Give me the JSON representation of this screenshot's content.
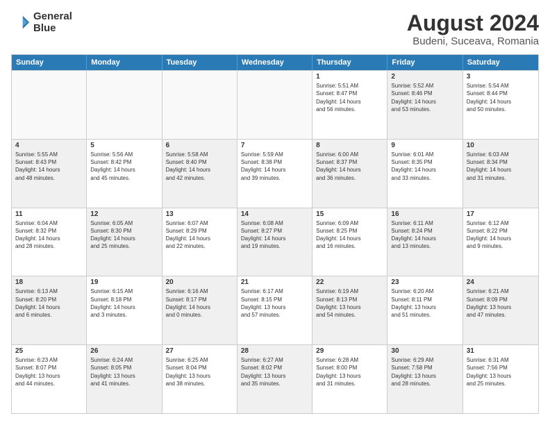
{
  "logo": {
    "line1": "General",
    "line2": "Blue"
  },
  "title": "August 2024",
  "subtitle": "Budeni, Suceava, Romania",
  "days": [
    "Sunday",
    "Monday",
    "Tuesday",
    "Wednesday",
    "Thursday",
    "Friday",
    "Saturday"
  ],
  "rows": [
    [
      {
        "day": "",
        "info": "",
        "empty": true
      },
      {
        "day": "",
        "info": "",
        "empty": true
      },
      {
        "day": "",
        "info": "",
        "empty": true
      },
      {
        "day": "",
        "info": "",
        "empty": true
      },
      {
        "day": "1",
        "info": "Sunrise: 5:51 AM\nSunset: 8:47 PM\nDaylight: 14 hours\nand 56 minutes.",
        "shaded": false
      },
      {
        "day": "2",
        "info": "Sunrise: 5:52 AM\nSunset: 8:46 PM\nDaylight: 14 hours\nand 53 minutes.",
        "shaded": true
      },
      {
        "day": "3",
        "info": "Sunrise: 5:54 AM\nSunset: 8:44 PM\nDaylight: 14 hours\nand 50 minutes.",
        "shaded": false
      }
    ],
    [
      {
        "day": "4",
        "info": "Sunrise: 5:55 AM\nSunset: 8:43 PM\nDaylight: 14 hours\nand 48 minutes.",
        "shaded": true
      },
      {
        "day": "5",
        "info": "Sunrise: 5:56 AM\nSunset: 8:42 PM\nDaylight: 14 hours\nand 45 minutes.",
        "shaded": false
      },
      {
        "day": "6",
        "info": "Sunrise: 5:58 AM\nSunset: 8:40 PM\nDaylight: 14 hours\nand 42 minutes.",
        "shaded": true
      },
      {
        "day": "7",
        "info": "Sunrise: 5:59 AM\nSunset: 8:38 PM\nDaylight: 14 hours\nand 39 minutes.",
        "shaded": false
      },
      {
        "day": "8",
        "info": "Sunrise: 6:00 AM\nSunset: 8:37 PM\nDaylight: 14 hours\nand 36 minutes.",
        "shaded": true
      },
      {
        "day": "9",
        "info": "Sunrise: 6:01 AM\nSunset: 8:35 PM\nDaylight: 14 hours\nand 33 minutes.",
        "shaded": false
      },
      {
        "day": "10",
        "info": "Sunrise: 6:03 AM\nSunset: 8:34 PM\nDaylight: 14 hours\nand 31 minutes.",
        "shaded": true
      }
    ],
    [
      {
        "day": "11",
        "info": "Sunrise: 6:04 AM\nSunset: 8:32 PM\nDaylight: 14 hours\nand 28 minutes.",
        "shaded": false
      },
      {
        "day": "12",
        "info": "Sunrise: 6:05 AM\nSunset: 8:30 PM\nDaylight: 14 hours\nand 25 minutes.",
        "shaded": true
      },
      {
        "day": "13",
        "info": "Sunrise: 6:07 AM\nSunset: 8:29 PM\nDaylight: 14 hours\nand 22 minutes.",
        "shaded": false
      },
      {
        "day": "14",
        "info": "Sunrise: 6:08 AM\nSunset: 8:27 PM\nDaylight: 14 hours\nand 19 minutes.",
        "shaded": true
      },
      {
        "day": "15",
        "info": "Sunrise: 6:09 AM\nSunset: 8:25 PM\nDaylight: 14 hours\nand 16 minutes.",
        "shaded": false
      },
      {
        "day": "16",
        "info": "Sunrise: 6:11 AM\nSunset: 8:24 PM\nDaylight: 14 hours\nand 13 minutes.",
        "shaded": true
      },
      {
        "day": "17",
        "info": "Sunrise: 6:12 AM\nSunset: 8:22 PM\nDaylight: 14 hours\nand 9 minutes.",
        "shaded": false
      }
    ],
    [
      {
        "day": "18",
        "info": "Sunrise: 6:13 AM\nSunset: 8:20 PM\nDaylight: 14 hours\nand 6 minutes.",
        "shaded": true
      },
      {
        "day": "19",
        "info": "Sunrise: 6:15 AM\nSunset: 8:18 PM\nDaylight: 14 hours\nand 3 minutes.",
        "shaded": false
      },
      {
        "day": "20",
        "info": "Sunrise: 6:16 AM\nSunset: 8:17 PM\nDaylight: 14 hours\nand 0 minutes.",
        "shaded": true
      },
      {
        "day": "21",
        "info": "Sunrise: 6:17 AM\nSunset: 8:15 PM\nDaylight: 13 hours\nand 57 minutes.",
        "shaded": false
      },
      {
        "day": "22",
        "info": "Sunrise: 6:19 AM\nSunset: 8:13 PM\nDaylight: 13 hours\nand 54 minutes.",
        "shaded": true
      },
      {
        "day": "23",
        "info": "Sunrise: 6:20 AM\nSunset: 8:11 PM\nDaylight: 13 hours\nand 51 minutes.",
        "shaded": false
      },
      {
        "day": "24",
        "info": "Sunrise: 6:21 AM\nSunset: 8:09 PM\nDaylight: 13 hours\nand 47 minutes.",
        "shaded": true
      }
    ],
    [
      {
        "day": "25",
        "info": "Sunrise: 6:23 AM\nSunset: 8:07 PM\nDaylight: 13 hours\nand 44 minutes.",
        "shaded": false
      },
      {
        "day": "26",
        "info": "Sunrise: 6:24 AM\nSunset: 8:05 PM\nDaylight: 13 hours\nand 41 minutes.",
        "shaded": true
      },
      {
        "day": "27",
        "info": "Sunrise: 6:25 AM\nSunset: 8:04 PM\nDaylight: 13 hours\nand 38 minutes.",
        "shaded": false
      },
      {
        "day": "28",
        "info": "Sunrise: 6:27 AM\nSunset: 8:02 PM\nDaylight: 13 hours\nand 35 minutes.",
        "shaded": true
      },
      {
        "day": "29",
        "info": "Sunrise: 6:28 AM\nSunset: 8:00 PM\nDaylight: 13 hours\nand 31 minutes.",
        "shaded": false
      },
      {
        "day": "30",
        "info": "Sunrise: 6:29 AM\nSunset: 7:58 PM\nDaylight: 13 hours\nand 28 minutes.",
        "shaded": true
      },
      {
        "day": "31",
        "info": "Sunrise: 6:31 AM\nSunset: 7:56 PM\nDaylight: 13 hours\nand 25 minutes.",
        "shaded": false
      }
    ]
  ]
}
